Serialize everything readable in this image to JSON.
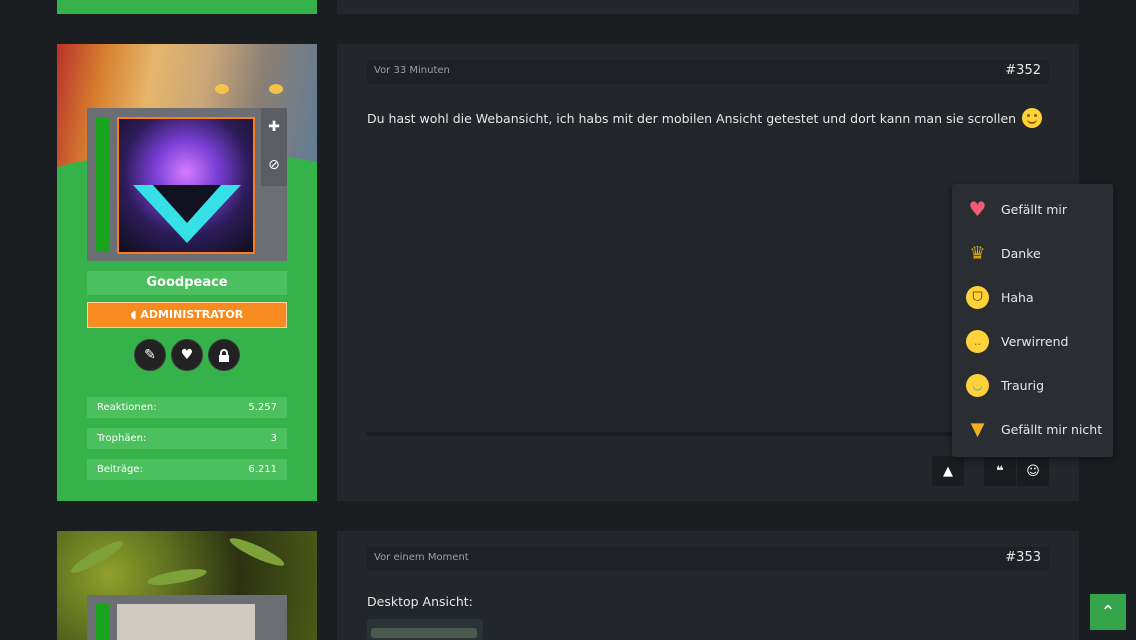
{
  "post1": {
    "time": "Vor 33 Minuten",
    "number": "#352",
    "message": "Du hast wohl die Webansicht, ich habs mit der mobilen Ansicht getestet und dort kann man sie scrollen",
    "user": {
      "name": "Goodpeace",
      "role": "ADMINISTRATOR",
      "role_color": "#f78b1f",
      "stats": [
        {
          "label": "Reaktionen:",
          "value": "5.257"
        },
        {
          "label": "Trophäen:",
          "value": "3"
        },
        {
          "label": "Beiträge:",
          "value": "6.211"
        }
      ]
    }
  },
  "reactions": [
    {
      "label": "Gefällt mir",
      "icon": "heart-icon",
      "color": "#f25b73"
    },
    {
      "label": "Danke",
      "icon": "trophy-icon",
      "color": "#d9a21c"
    },
    {
      "label": "Haha",
      "icon": "laugh-icon",
      "color": "#ffd23a"
    },
    {
      "label": "Verwirrend",
      "icon": "confused-icon",
      "color": "#ffd23a"
    },
    {
      "label": "Traurig",
      "icon": "sad-icon",
      "color": "#ffd23a"
    },
    {
      "label": "Gefällt mir nicht",
      "icon": "thumbs-down-icon",
      "color": "#f2b01e"
    }
  ],
  "post2": {
    "time": "Vor einem Moment",
    "number": "#353",
    "message": "Desktop Ansicht:"
  },
  "colors": {
    "accent": "#35b24a",
    "page_bg": "#1b1e21",
    "panel_bg": "#23272b"
  }
}
